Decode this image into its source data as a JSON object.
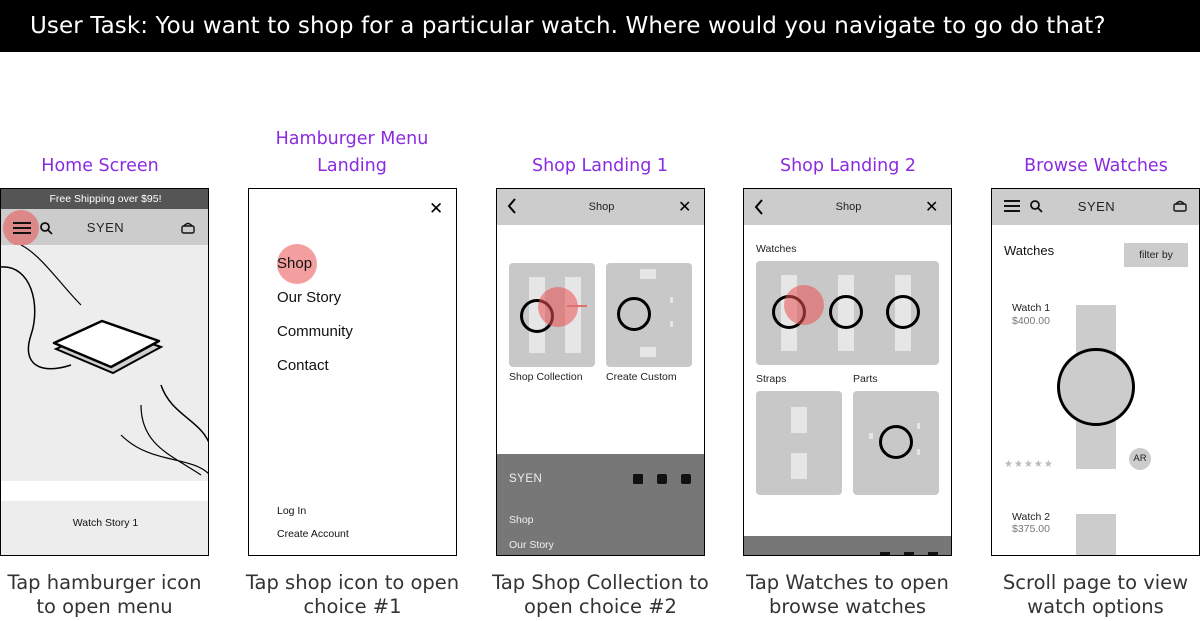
{
  "header": {
    "task": "User Task:  You want to shop for a particular watch. Where would you navigate to go do that?"
  },
  "screens": [
    {
      "title": "Home Screen",
      "caption": "Tap hamburger icon to open menu",
      "banner": "Free Shipping over $95!",
      "brand": "SYEN",
      "story_label": "Watch Story 1"
    },
    {
      "title": "Hamburger Menu Landing",
      "caption": "Tap shop icon to open choice #1",
      "menu": [
        "Shop",
        "Our Story",
        "Community",
        "Contact"
      ],
      "account": [
        "Log In",
        "Create Account"
      ]
    },
    {
      "title": "Shop Landing 1",
      "caption": "Tap Shop Collection to open choice #2",
      "nav_title": "Shop",
      "cards": [
        "Shop Collection",
        "Create Custom"
      ],
      "footer": {
        "brand": "SYEN",
        "links": [
          "Shop",
          "Our Story"
        ]
      }
    },
    {
      "title": "Shop Landing 2",
      "caption": "Tap Watches to open browse watches",
      "nav_title": "Shop",
      "sections": [
        "Watches",
        "Straps",
        "Parts"
      ]
    },
    {
      "title": "Browse Watches",
      "caption": "Scroll page to view watch options",
      "brand": "SYEN",
      "heading": "Watches",
      "filter_label": "filter by",
      "ar_label": "AR",
      "rating_stars": "★★★★★",
      "products": [
        {
          "name": "Watch 1",
          "price": "$400.00"
        },
        {
          "name": "Watch 2",
          "price": "$375.00"
        }
      ]
    }
  ]
}
